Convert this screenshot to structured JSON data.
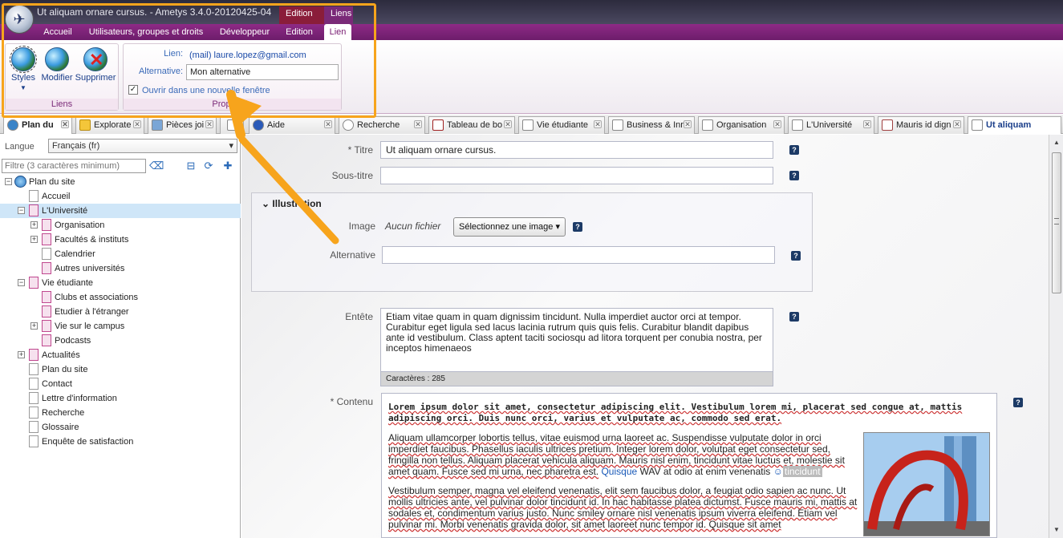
{
  "window": {
    "title": "Ut aliquam ornare cursus. - Ametys 3.4.0-20120425-04",
    "context_tabs": [
      "Edition",
      "Liens"
    ]
  },
  "menu": {
    "tabs": [
      "Accueil",
      "Utilisateurs, groupes et droits",
      "Développeur",
      "Edition",
      "Lien"
    ],
    "active": "Lien"
  },
  "ribbon": {
    "liens_group": {
      "label": "Liens",
      "buttons": [
        "Styles",
        "Modifier",
        "Supprimer"
      ]
    },
    "props_group": {
      "label": "Propriétés",
      "link_label": "Lien:",
      "link_value": "(mail) laure.lopez@gmail.com",
      "alt_label": "Alternative:",
      "alt_value": "Mon alternative",
      "new_window_label": "Ouvrir dans une nouvelle fenêtre",
      "new_window_checked": true
    }
  },
  "doc_tabs": [
    "Plan du",
    "Explorate",
    "Pièces joi",
    "",
    "Aide",
    "Recherche",
    "Tableau de bo",
    "Vie étudiante",
    "Business & Inr",
    "Organisation",
    "L'Université",
    "Mauris id dign",
    "Ut aliquam"
  ],
  "sidebar": {
    "lang_label": "Langue",
    "lang_value": "Français (fr)",
    "filter_placeholder": "Filtre (3 caractères minimum)",
    "tree": [
      {
        "label": "Plan du site"
      },
      {
        "label": "Accueil"
      },
      {
        "label": "L'Université"
      },
      {
        "label": "Organisation"
      },
      {
        "label": "Facultés & instituts"
      },
      {
        "label": "Calendrier"
      },
      {
        "label": "Autres universités"
      },
      {
        "label": "Vie étudiante"
      },
      {
        "label": "Clubs et associations"
      },
      {
        "label": "Etudier à l'étranger"
      },
      {
        "label": "Vie sur le campus"
      },
      {
        "label": "Podcasts"
      },
      {
        "label": "Actualités"
      },
      {
        "label": "Plan du site"
      },
      {
        "label": "Contact"
      },
      {
        "label": "Lettre d'information"
      },
      {
        "label": "Recherche"
      },
      {
        "label": "Glossaire"
      },
      {
        "label": "Enquête de satisfaction"
      }
    ]
  },
  "form": {
    "titre_label": "* Titre",
    "titre_value": "Ut aliquam ornare cursus.",
    "soustitre_label": "Sous-titre",
    "soustitre_value": "",
    "illustration_title": "Illustration",
    "image_label": "Image",
    "image_value": "Aucun fichier",
    "image_button": "Sélectionnez une image",
    "alt_label": "Alternative",
    "alt_value": "",
    "entete_label": "Entête",
    "entete_value": "Etiam vitae quam in quam dignissim tincidunt. Nulla imperdiet auctor orci at tempor. Curabitur eget ligula sed lacus lacinia rutrum quis quis felis. Curabitur blandit dapibus ante id vestibulum. Class aptent taciti sociosqu ad litora torquent per conubia nostra, per inceptos himenaeos",
    "entete_counter": "Caractères : 285",
    "contenu_label": "* Contenu",
    "contenu_bold": "Lorem ipsum dolor sit amet, consectetur adipiscing elit. Vestibulum lorem mi, placerat sed congue at, mattis adipiscing orci. Duis nunc orci, varius et vulputate ac, commodo sed erat.",
    "contenu_p1": "Aliquam ullamcorper lobortis tellus, vitae euismod urna laoreet ac. Suspendisse vulputate dolor in orci imperdiet faucibus. Phasellus iaculis ultrices pretium. Integer lorem dolor, volutpat eget consectetur sed, fringilla non tellus. Aliquam placerat vehicula aliquam. Mauris nisl enim, tincidunt vitae luctus et, molestie sit amet quam. Fusce sed mi urna, nec pharetra est.",
    "contenu_link": "Quisque",
    "contenu_p1_tail": "WAV at odio at enim venenatis",
    "contenu_tag": "tincidunt",
    "contenu_p2": "Vestibulum semper, magna vel eleifend venenatis, elit sem faucibus dolor, a feugiat odio sapien ac nunc. Ut mollis ultricies ante, vel pulvinar dolor tincidunt id. In hac habitasse platea dictumst. Fusce mauris mi, mattis at sodales et, condimentum varius justo. Nunc smiley ornare nisl venenatis ipsum viverra eleifend. Etiam vel pulvinar mi. Morbi venenatis gravida dolor, sit amet laoreet nunc tempor id. Quisque sit amet"
  },
  "colors": {
    "accent": "#7b2074",
    "highlight": "#f7a41c",
    "selection": "#cfe6f8"
  }
}
